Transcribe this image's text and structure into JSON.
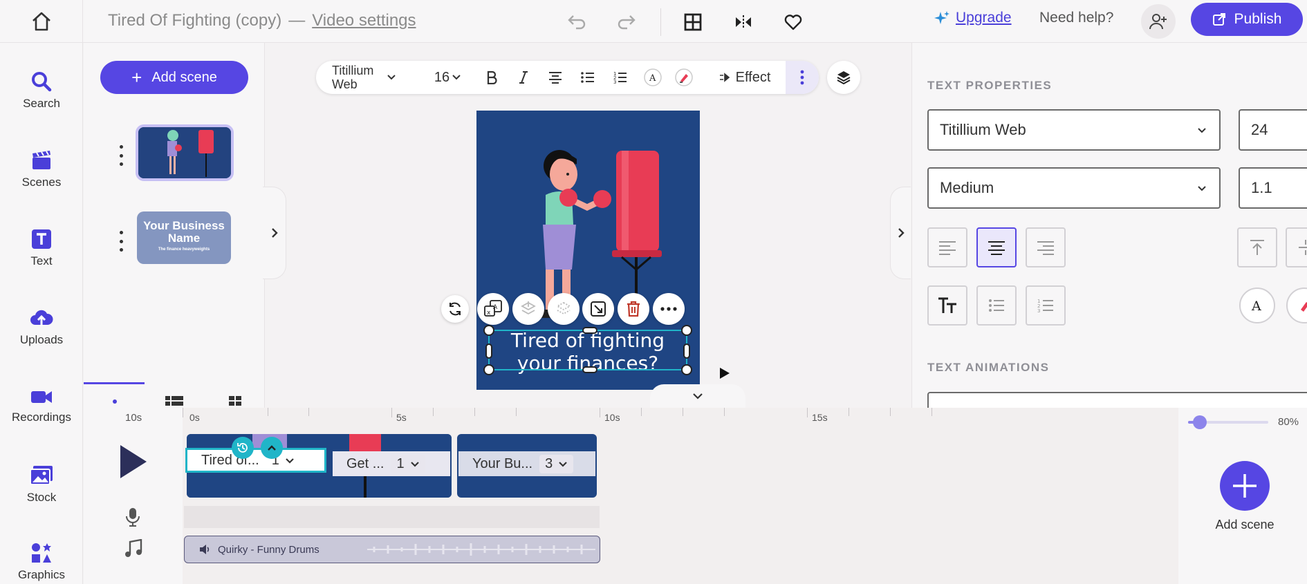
{
  "header": {
    "project_title": "Tired Of Fighting (copy)",
    "separator": "—",
    "settings_link": "Video settings",
    "upgrade_label": "Upgrade",
    "help_label": "Need help?",
    "publish_label": "Publish"
  },
  "leftnav": {
    "items": [
      {
        "label": "Search",
        "icon": "search-icon"
      },
      {
        "label": "Scenes",
        "icon": "clapperboard-icon"
      },
      {
        "label": "Text",
        "icon": "text-icon"
      },
      {
        "label": "Uploads",
        "icon": "upload-cloud-icon"
      },
      {
        "label": "Recordings",
        "icon": "video-camera-icon"
      },
      {
        "label": "Stock",
        "icon": "images-icon"
      },
      {
        "label": "Graphics",
        "icon": "shapes-icon"
      }
    ]
  },
  "scenes": {
    "add_label": "Add scene",
    "thumb2_title": "Your Business Name",
    "thumb2_sub": "The finance heavyweights"
  },
  "toolbar": {
    "font": "Titillium Web",
    "size": "16",
    "effect_label": "Effect"
  },
  "canvas": {
    "text": "Tired of fighting your finances?"
  },
  "properties": {
    "text_heading": "TEXT PROPERTIES",
    "font": "Titillium Web",
    "size": "24",
    "weight": "Medium",
    "line_height": "1.1",
    "animations_heading": "TEXT ANIMATIONS"
  },
  "timeline": {
    "duration_label": "10s",
    "ticks": [
      "0s",
      "5s",
      "10s",
      "15s"
    ],
    "clips": [
      {
        "label": "Tired of...",
        "count": "1"
      },
      {
        "label": "Get ...",
        "count": "1"
      },
      {
        "label": "Your Bu...",
        "count": "3"
      }
    ],
    "audio_label": "Quirky - Funny Drums",
    "zoom": "80%",
    "zoom_fraction": 0.8,
    "add_scene_label": "Add scene"
  },
  "colors": {
    "accent": "#5646e3",
    "canvas_bg": "#1f4583",
    "selection": "#20b5c8"
  }
}
